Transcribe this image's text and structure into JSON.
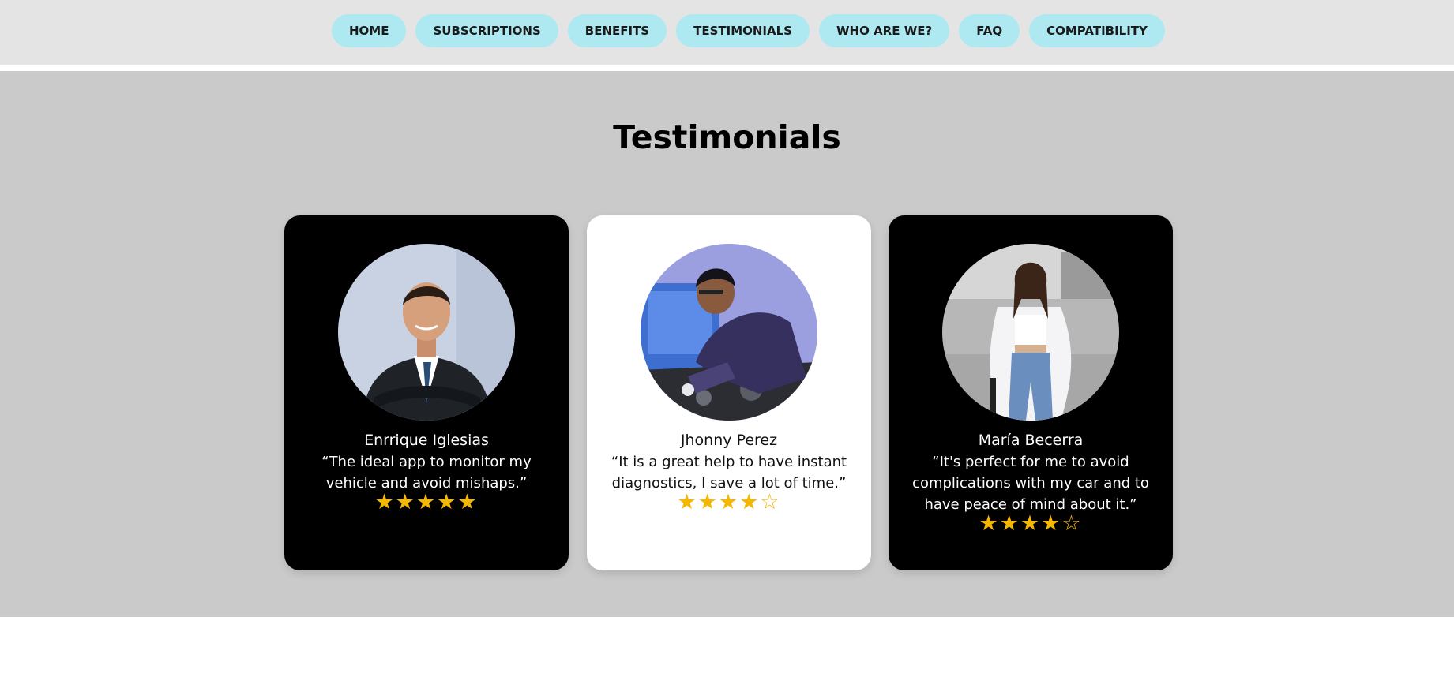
{
  "nav": {
    "items": [
      {
        "label": "HOME"
      },
      {
        "label": "SUBSCRIPTIONS"
      },
      {
        "label": "BENEFITS"
      },
      {
        "label": "TESTIMONIALS"
      },
      {
        "label": "WHO ARE WE?"
      },
      {
        "label": "FAQ"
      },
      {
        "label": "COMPATIBILITY"
      }
    ]
  },
  "testimonials": {
    "title": "Testimonials",
    "cards": [
      {
        "name": "Enrrique Iglesias",
        "quote": "“The ideal app to monitor my vehicle and avoid mishaps.”",
        "rating": 5,
        "max_rating": 5,
        "theme": "dark"
      },
      {
        "name": "Jhonny Perez",
        "quote": "“It is a great help to have instant diagnostics, I save a lot of time.”",
        "rating": 4,
        "max_rating": 5,
        "theme": "light"
      },
      {
        "name": "María Becerra",
        "quote": "“It's perfect for me to avoid complications with my car and to have peace of mind about it.”",
        "rating": 4,
        "max_rating": 5,
        "theme": "dark"
      }
    ]
  },
  "colors": {
    "nav_bg": "#e4e4e4",
    "nav_button": "#aee9f2",
    "section_bg": "#cacaca",
    "star": "#f6b700"
  }
}
